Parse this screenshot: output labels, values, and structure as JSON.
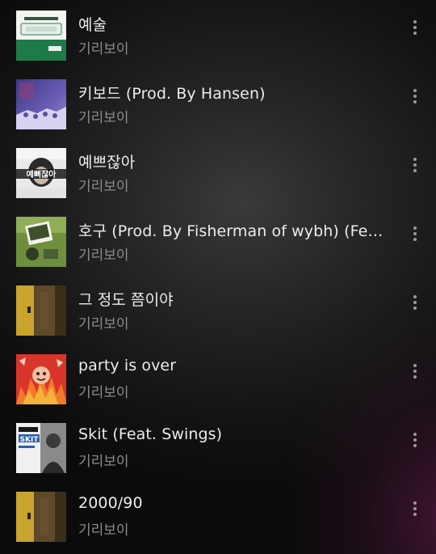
{
  "tracks": [
    {
      "title": "예술",
      "artist": "기리보이",
      "art_icon": "album-cover-white-green"
    },
    {
      "title": "키보드 (Prod. By Hansen)",
      "artist": "기리보이",
      "art_icon": "album-cover-purple-crowd"
    },
    {
      "title": "예쁘잖아",
      "artist": "기리보이",
      "art_icon": "album-cover-portrait-text",
      "art_text": "예뻐잖아"
    },
    {
      "title": "호구 (Prod. By Fisherman of wybh) (Feat. …",
      "artist": "기리보이",
      "art_icon": "album-cover-green-photo"
    },
    {
      "title": "그 정도 쯤이야",
      "artist": "기리보이",
      "art_icon": "album-cover-yellow-door"
    },
    {
      "title": "party is over",
      "artist": "기리보이",
      "art_icon": "album-cover-red-flame"
    },
    {
      "title": "Skit (Feat. Swings)",
      "artist": "기리보이",
      "art_icon": "album-cover-skit",
      "art_text": "SKIT"
    },
    {
      "title": "2000/90",
      "artist": "기리보이",
      "art_icon": "album-cover-yellow-door"
    }
  ],
  "more_icon": "vertical-ellipsis-icon",
  "colors": {
    "title": "#ececec",
    "artist": "#8d8d8f",
    "background": "#1c1c1e",
    "accent_glow": "#6e1e50"
  }
}
